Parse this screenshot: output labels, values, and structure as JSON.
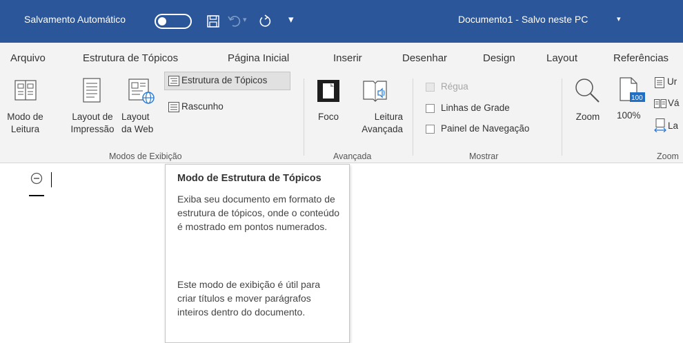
{
  "titlebar": {
    "autosave_label": "Salvamento Automático",
    "document_title": "Documento1  -  Salvo neste PC",
    "title_dropdown": "▾",
    "qat_customize": "▾",
    "undo_dropdown": "▾",
    "autosave_on": false,
    "bg_color": "#2b579a"
  },
  "tabs": [
    {
      "label": "Arquivo"
    },
    {
      "label": "Estrutura de Tópicos"
    },
    {
      "label": "Página Inicial"
    },
    {
      "label": "Inserir"
    },
    {
      "label": "Desenhar"
    },
    {
      "label": "Design"
    },
    {
      "label": "Layout"
    },
    {
      "label": "Referências"
    }
  ],
  "ribbon": {
    "modos": {
      "group_label": "Modos de Exibição",
      "modo_leitura": [
        "Modo de",
        "Leitura"
      ],
      "layout_impressao": [
        "Layout de",
        "Impressão"
      ],
      "layout_web": [
        "Layout",
        "da Web"
      ],
      "estrutura": "Estrutura de Tópicos",
      "rascunho": "Rascunho"
    },
    "avancada": {
      "group_label": "Avançada",
      "foco": "Foco",
      "leitura_avancada": [
        "Leitura",
        "Avançada"
      ]
    },
    "mostrar": {
      "group_label": "Mostrar",
      "regua": "Régua",
      "linhas_grade": "Linhas de Grade",
      "painel_navegacao": "Painel de Navegação"
    },
    "zoom": {
      "group_label": "Zoom",
      "zoom": "Zoom",
      "hundred": "100%",
      "hundred_badge": "100",
      "uma_pagina": "Ur",
      "varias_paginas": "Vá",
      "largura": "La"
    }
  },
  "tooltip": {
    "title": "Modo de Estrutura de Tópicos",
    "paragraph1": "Exiba seu documento em formato de estrutura de tópicos, onde o conteúdo é mostrado em pontos numerados.",
    "paragraph2": "Este modo de exibição é útil para criar títulos e mover parágrafos inteiros dentro do documento."
  }
}
